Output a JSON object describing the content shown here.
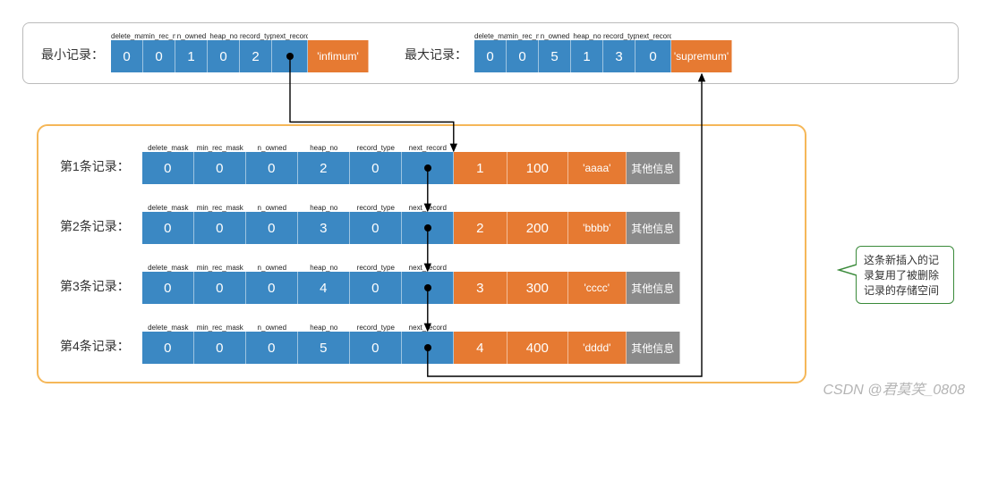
{
  "header_fields": [
    "delete_mask",
    "min_rec_mask",
    "n_owned",
    "heap_no",
    "record_type",
    "next_record"
  ],
  "top": {
    "min": {
      "label": "最小记录：",
      "values": [
        "0",
        "0",
        "1",
        "0",
        "2",
        "",
        ""
      ],
      "tag": "'infimum'"
    },
    "max": {
      "label": "最大记录：",
      "values": [
        "0",
        "0",
        "5",
        "1",
        "3",
        "0",
        ""
      ],
      "tag": "'supremum'"
    }
  },
  "rows": [
    {
      "label": "第1条记录：",
      "header": [
        "0",
        "0",
        "0",
        "2",
        "0",
        ""
      ],
      "data": [
        "1",
        "100",
        "'aaaa'"
      ],
      "other": "其他信息"
    },
    {
      "label": "第2条记录：",
      "header": [
        "0",
        "0",
        "0",
        "3",
        "0",
        ""
      ],
      "data": [
        "2",
        "200",
        "'bbbb'"
      ],
      "other": "其他信息"
    },
    {
      "label": "第3条记录：",
      "header": [
        "0",
        "0",
        "0",
        "4",
        "0",
        ""
      ],
      "data": [
        "3",
        "300",
        "'cccc'"
      ],
      "other": "其他信息"
    },
    {
      "label": "第4条记录：",
      "header": [
        "0",
        "0",
        "0",
        "5",
        "0",
        ""
      ],
      "data": [
        "4",
        "400",
        "'dddd'"
      ],
      "other": "其他信息"
    }
  ],
  "callout_text": "这条新插入的记录复用了被删除记录的存储空间",
  "watermark": "CSDN @君莫笑_0808"
}
